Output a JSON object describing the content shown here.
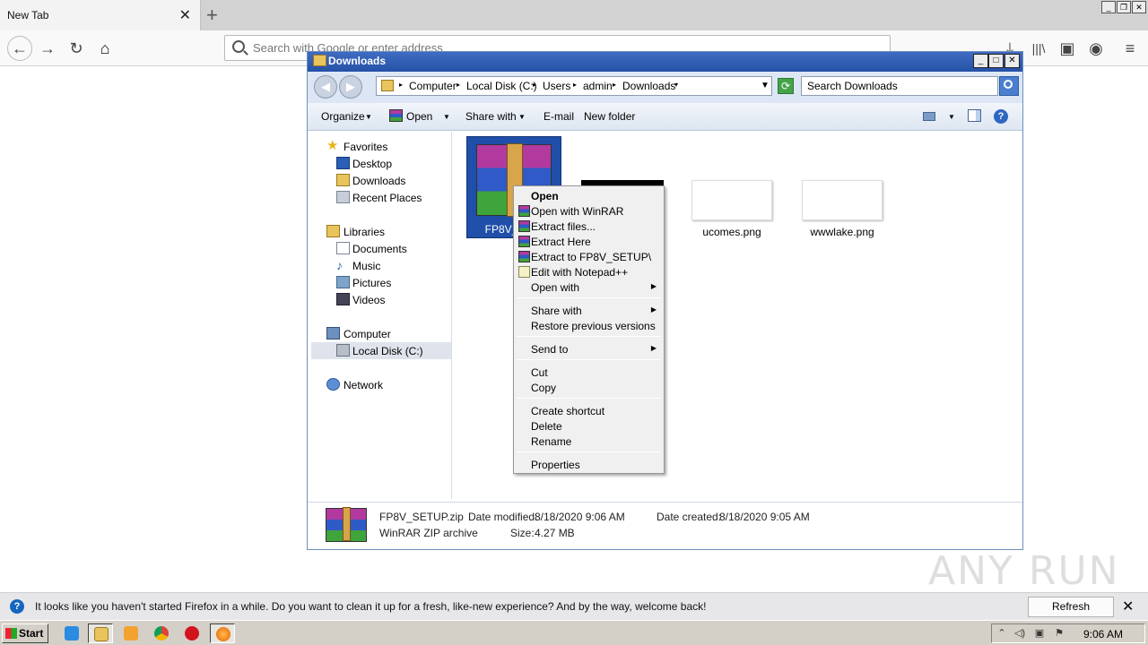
{
  "firefox": {
    "tab_title": "New Tab",
    "new_tab_glyph": "+",
    "close_glyph": "✕",
    "url_placeholder": "Search with Google or enter address",
    "icons": [
      "back-icon",
      "forward-icon",
      "reload-icon",
      "home-icon",
      "download-icon",
      "library-icon",
      "sidebar-icon",
      "account-icon",
      "menu-icon"
    ]
  },
  "explorer": {
    "title": "Downloads",
    "breadcrumb": [
      "Computer",
      "Local Disk (C:)",
      "Users",
      "admin",
      "Downloads"
    ],
    "search_placeholder": "Search Downloads",
    "commands": {
      "organize": "Organize",
      "open": "Open",
      "share_with": "Share with",
      "email": "E-mail",
      "new_folder": "New folder"
    },
    "nav": {
      "favorites": "Favorites",
      "desktop": "Desktop",
      "downloads": "Downloads",
      "recent_places": "Recent Places",
      "libraries": "Libraries",
      "documents": "Documents",
      "music": "Music",
      "pictures": "Pictures",
      "videos": "Videos",
      "computer": "Computer",
      "local_disk": "Local Disk (C:)",
      "network": "Network"
    },
    "files": [
      {
        "name": "FP8V_SE",
        "selected": true
      },
      {
        "name": "ucomes.png"
      },
      {
        "name": "wwwlake.png"
      }
    ],
    "details": {
      "filename": "FP8V_SETUP.zip",
      "type": "WinRAR ZIP archive",
      "modified_label": "Date modified:",
      "modified_value": "8/18/2020 9:06 AM",
      "created_label": "Date created:",
      "created_value": "8/18/2020 9:05 AM",
      "size_label": "Size:",
      "size_value": "4.27 MB"
    }
  },
  "context_menu": {
    "open": "Open",
    "open_with_winrar": "Open with WinRAR",
    "extract_files": "Extract files...",
    "extract_here": "Extract Here",
    "extract_to": "Extract to FP8V_SETUP\\",
    "edit_notepad": "Edit with Notepad++",
    "open_with": "Open with",
    "share_with": "Share with",
    "restore": "Restore previous versions",
    "send_to": "Send to",
    "cut": "Cut",
    "copy": "Copy",
    "create_shortcut": "Create shortcut",
    "delete": "Delete",
    "rename": "Rename",
    "properties": "Properties"
  },
  "notification": {
    "message": "It looks like you haven't started Firefox in a while. Do you want to clean it up for a fresh, like-new experience? And by the way, welcome back!",
    "button": "Refresh Firefox…"
  },
  "taskbar": {
    "start": "Start",
    "clock": "9:06 AM"
  },
  "watermark": "ANY RUN"
}
